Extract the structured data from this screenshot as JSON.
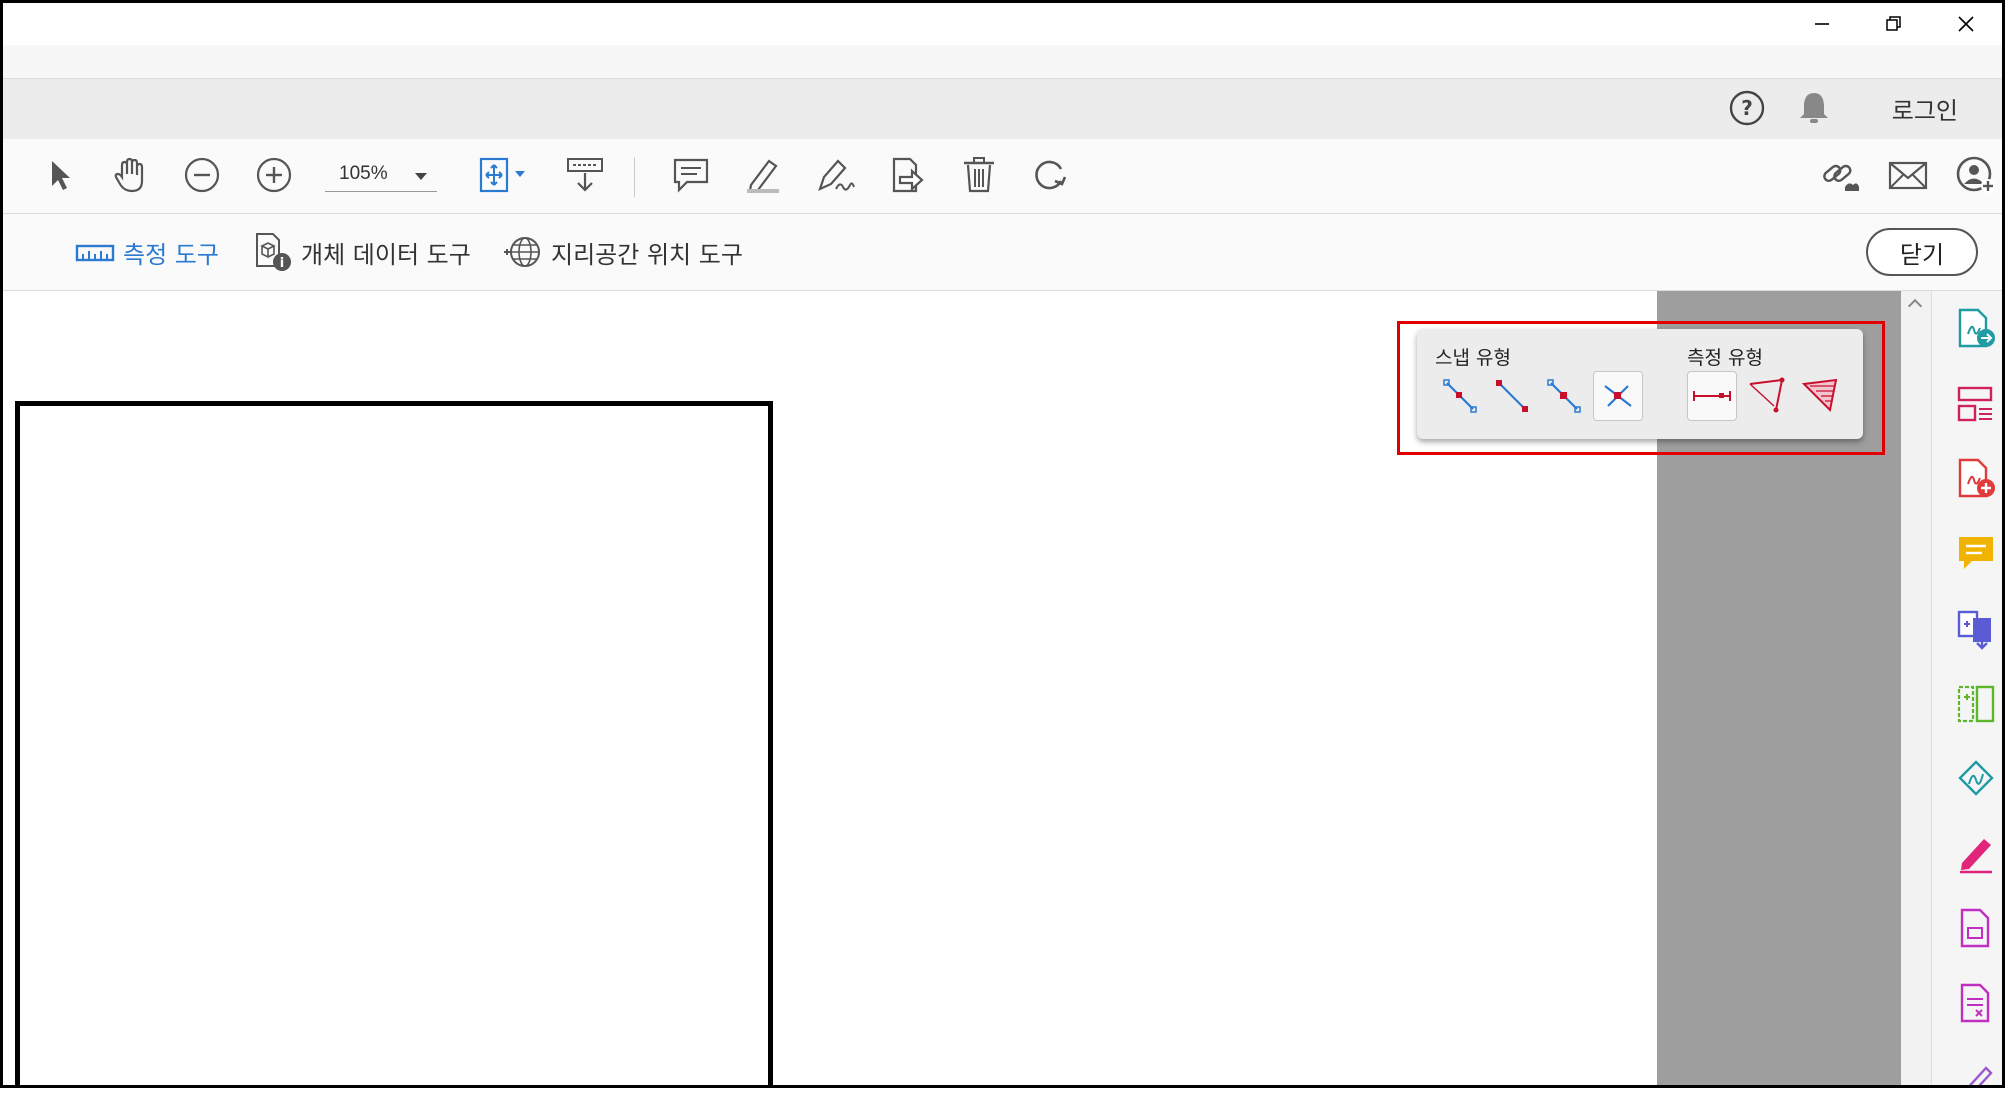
{
  "window": {
    "minimize_icon": "minimize-icon",
    "restore_icon": "restore-icon",
    "close_icon": "close-icon"
  },
  "menubar": {
    "login_label": "로그인",
    "help_icon": "help-circle-icon",
    "bell_icon": "bell-icon"
  },
  "toolbar": {
    "zoom_value": "105%",
    "tools": [
      "select-arrow-icon",
      "hand-icon",
      "zoom-out-icon",
      "zoom-in-icon",
      "fit-page-icon",
      "scroll-mode-icon",
      "comment-icon",
      "highlight-pen-icon",
      "sign-icon",
      "share-icon",
      "delete-icon",
      "rotate-icon"
    ],
    "right_tools": [
      "link-icon",
      "email-icon",
      "add-user-icon"
    ]
  },
  "subbar": {
    "tools": [
      {
        "label": "측정 도구",
        "icon": "ruler-icon",
        "active": true
      },
      {
        "label": "개체 데이터 도구",
        "icon": "object-data-icon",
        "active": false
      },
      {
        "label": "지리공간 위치 도구",
        "icon": "globe-icon",
        "active": false
      }
    ],
    "close_label": "닫기"
  },
  "measure_panel": {
    "snap_label": "스냅 유형",
    "measure_label": "측정 유형",
    "snap_types": [
      "snap-to-path-icon",
      "snap-to-endpoint-icon",
      "snap-to-midpoint-icon",
      "snap-to-intersection-icon"
    ],
    "selected_snap": 3,
    "measure_types": [
      "distance-icon",
      "perimeter-icon",
      "area-icon"
    ],
    "selected_measure": 0
  },
  "right_pane": {
    "icons": [
      "export-pdf-icon",
      "organize-pages-icon",
      "create-pdf-icon",
      "comment-icon",
      "combine-files-icon",
      "compare-files-icon",
      "protect-icon",
      "fill-sign-icon",
      "document-icon",
      "form-icon",
      "edit-icon"
    ]
  },
  "colors": {
    "accent": "#2a7ad1",
    "highlight_border": "#e00000",
    "measure_red": "#c8102e"
  }
}
